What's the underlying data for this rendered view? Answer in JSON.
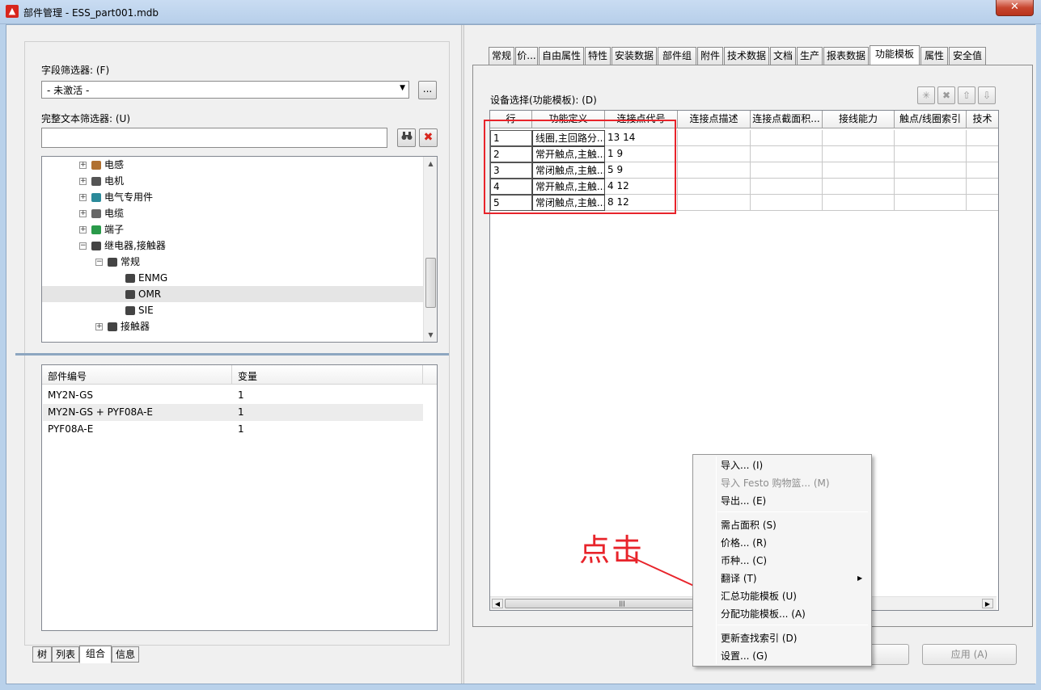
{
  "window": {
    "title": "部件管理 - ESS_part001.mdb",
    "close_label": "✕",
    "app_icon_label": "▲"
  },
  "filters": {
    "field_filter_label": "字段筛选器: (F)",
    "field_filter_value": "- 未激活 -",
    "field_filter_more": "...",
    "text_filter_label": "完整文本筛选器: (U)",
    "text_filter_value": ""
  },
  "tree": {
    "items": [
      {
        "label": "电感",
        "level": 0,
        "expander": "+"
      },
      {
        "label": "电机",
        "level": 0,
        "expander": "+"
      },
      {
        "label": "电气专用件",
        "level": 0,
        "expander": "+"
      },
      {
        "label": "电缆",
        "level": 0,
        "expander": "+"
      },
      {
        "label": "端子",
        "level": 0,
        "expander": "+"
      },
      {
        "label": "继电器,接触器",
        "level": 0,
        "expander": "−"
      },
      {
        "label": "常规",
        "level": 1,
        "expander": "−"
      },
      {
        "label": "ENMG",
        "level": 2,
        "expander": ""
      },
      {
        "label": "OMR",
        "level": 2,
        "expander": "",
        "selected": true
      },
      {
        "label": "SIE",
        "level": 2,
        "expander": ""
      },
      {
        "label": "接触器",
        "level": 1,
        "expander": "+"
      }
    ]
  },
  "parts_list": {
    "columns": [
      "部件编号",
      "变量"
    ],
    "rows": [
      {
        "part": "MY2N-GS",
        "variant": "1"
      },
      {
        "part": "MY2N-GS + PYF08A-E",
        "variant": "1"
      },
      {
        "part": "PYF08A-E",
        "variant": "1"
      }
    ]
  },
  "left_tabs": [
    "树",
    "列表",
    "组合",
    "信息"
  ],
  "left_active_tab": "组合",
  "right_tabs": [
    "常规",
    "价...",
    "自由属性",
    "特性",
    "安装数据",
    "部件组",
    "附件",
    "技术数据",
    "文档",
    "生产",
    "报表数据",
    "功能模板",
    "属性",
    "安全值"
  ],
  "right_active_tab": "功能模板",
  "device_selection": {
    "label": "设备选择(功能模板): (D)",
    "columns": [
      "行",
      "功能定义",
      "连接点代号",
      "连接点描述",
      "连接点截面积...",
      "接线能力",
      "触点/线圈索引",
      "技术"
    ],
    "rows": [
      {
        "row": "1",
        "func": "线圈,主回路分...",
        "conn": "13 14"
      },
      {
        "row": "2",
        "func": "常开触点,主触...",
        "conn": "1 9"
      },
      {
        "row": "3",
        "func": "常闭触点,主触...",
        "conn": "5 9"
      },
      {
        "row": "4",
        "func": "常开触点,主触...",
        "conn": "4 12"
      },
      {
        "row": "5",
        "func": "常闭触点,主触...",
        "conn": "8 12"
      }
    ]
  },
  "annotation": {
    "text": "点击",
    "color": "#e8242b"
  },
  "context_menu": {
    "items": [
      {
        "label": "导入... (I)",
        "disabled": false
      },
      {
        "label": "导入 Festo 购物篮... (M)",
        "disabled": true
      },
      {
        "label": "导出... (E)",
        "disabled": false
      },
      {
        "label": "需占面积 (S)",
        "disabled": false
      },
      {
        "label": "价格... (R)",
        "disabled": false
      },
      {
        "label": "币种... (C)",
        "disabled": false
      },
      {
        "label": "翻译 (T)",
        "disabled": false,
        "submenu": true
      },
      {
        "label": "汇总功能模板 (U)",
        "disabled": false
      },
      {
        "label": "分配功能模板... (A)",
        "disabled": false
      },
      {
        "label": "更新查找索引 (D)",
        "disabled": false
      },
      {
        "label": "设置... (G)",
        "disabled": false
      }
    ]
  },
  "footer": {
    "apply_label": "应用 (A)"
  },
  "colors": {
    "accent_red": "#e8242b",
    "frame_blue": "#b9d1ea"
  }
}
